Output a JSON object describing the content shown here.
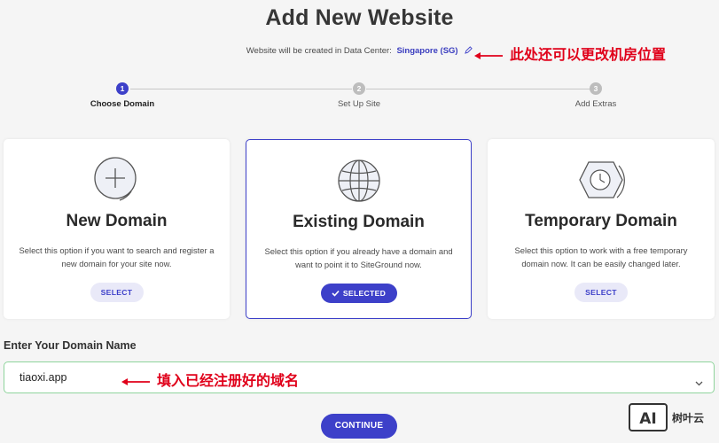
{
  "page": {
    "title": "Add New Website"
  },
  "datacenter": {
    "prefix": "Website will be created in Data Center:",
    "value": "Singapore (SG)"
  },
  "annotations": {
    "datacenter_note": "此处还可以更改机房位置",
    "domain_note": "填入已经注册好的域名"
  },
  "stepper": {
    "steps": [
      {
        "number": "1",
        "label": "Choose Domain",
        "active": true
      },
      {
        "number": "2",
        "label": "Set Up Site",
        "active": false
      },
      {
        "number": "3",
        "label": "Add Extras",
        "active": false
      }
    ]
  },
  "options": [
    {
      "title": "New Domain",
      "description": "Select this option if you want to search and register a new domain for your site now.",
      "button": "SELECT",
      "selected": false,
      "icon": "plus-circle-icon"
    },
    {
      "title": "Existing Domain",
      "description": "Select this option if you already have a domain and want to point it to SiteGround now.",
      "button": "SELECTED",
      "selected": true,
      "icon": "globe-icon"
    },
    {
      "title": "Temporary Domain",
      "description": "Select this option to work with a free temporary domain now. It can be easily changed later.",
      "button": "SELECT",
      "selected": false,
      "icon": "clock-icon"
    }
  ],
  "domain_input": {
    "label": "Enter Your Domain Name",
    "value": "tiaoxi.app"
  },
  "actions": {
    "continue": "CONTINUE"
  },
  "watermark": {
    "logo": "AI",
    "text": "树叶云"
  },
  "colors": {
    "accent": "#3d40c9",
    "annotation": "#e0001a",
    "input_border": "#8fd49c"
  }
}
